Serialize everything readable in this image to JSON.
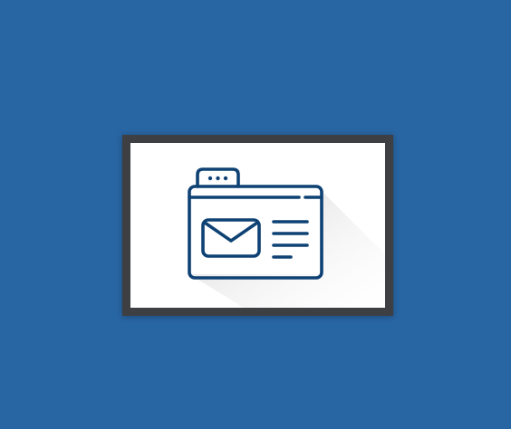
{
  "background_color": "#2865a3",
  "frame_color": "#3d3f42",
  "panel_color": "#ffffff",
  "icon": {
    "name": "email-browser-window-icon",
    "stroke_color": "#0f4274",
    "shadow_color": "#d9d9d9",
    "tab_dots": 3,
    "text_lines": 4
  }
}
